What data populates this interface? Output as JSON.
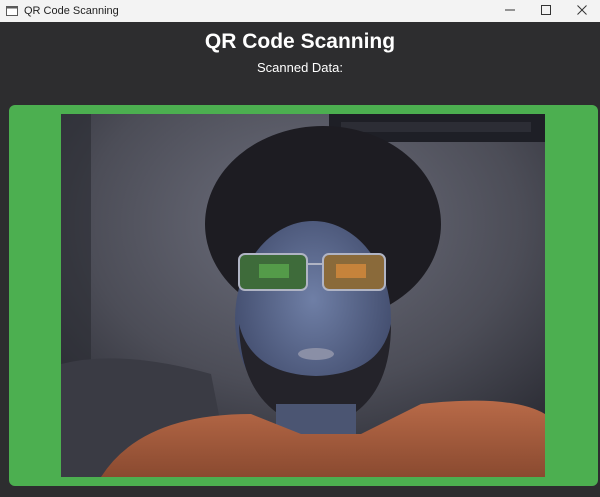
{
  "window": {
    "title": "QR Code Scanning",
    "controls": {
      "minimize_icon": "minimize-icon",
      "maximize_icon": "maximize-icon",
      "close_icon": "close-icon"
    }
  },
  "header": {
    "title": "QR Code Scanning",
    "scanned_label": "Scanned Data:"
  },
  "colors": {
    "background": "#2d2d2f",
    "frame": "#4caf50",
    "text": "#ffffff"
  }
}
